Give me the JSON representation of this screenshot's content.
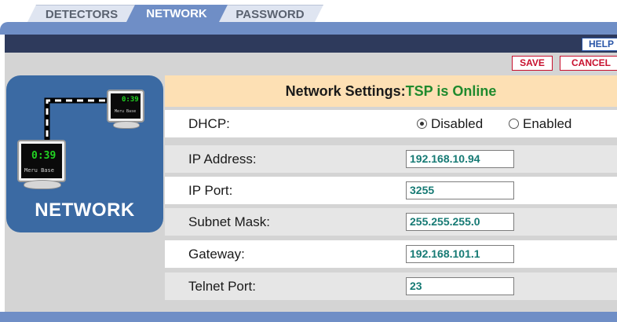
{
  "tabs": [
    {
      "label": "DETECTORS",
      "active": false
    },
    {
      "label": "NETWORK",
      "active": true
    },
    {
      "label": "PASSWORD",
      "active": false
    }
  ],
  "toolbar": {
    "help_label": "HELP",
    "save_label": "SAVE",
    "cancel_label": "CANCEL"
  },
  "icon": {
    "title": "NETWORK",
    "monitor_small": {
      "time": "0:39",
      "sub": "Meru Base"
    },
    "monitor_large": {
      "time": "0:39",
      "sub": "Meru Base"
    }
  },
  "settings": {
    "header_prefix": "Network Settings:",
    "header_status": "TSP is Online",
    "dhcp": {
      "label": "DHCP:",
      "options": [
        {
          "label": "Disabled",
          "selected": true
        },
        {
          "label": "Enabled",
          "selected": false
        }
      ]
    },
    "ip_address": {
      "label": "IP Address:",
      "value": "192.168.10.94"
    },
    "ip_port": {
      "label": "IP Port:",
      "value": "3255"
    },
    "subnet_mask": {
      "label": "Subnet Mask:",
      "value": "255.255.255.0"
    },
    "gateway": {
      "label": "Gateway:",
      "value": "192.168.101.1"
    },
    "telnet_port": {
      "label": "Telnet Port:",
      "value": "23"
    }
  },
  "colors": {
    "accent_blue": "#6f8ec6",
    "dark_bar": "#2e3a5c",
    "header_bg": "#fde0b4",
    "online_green": "#1f8a2d",
    "button_red": "#c8102e",
    "field_text": "#167a74"
  }
}
